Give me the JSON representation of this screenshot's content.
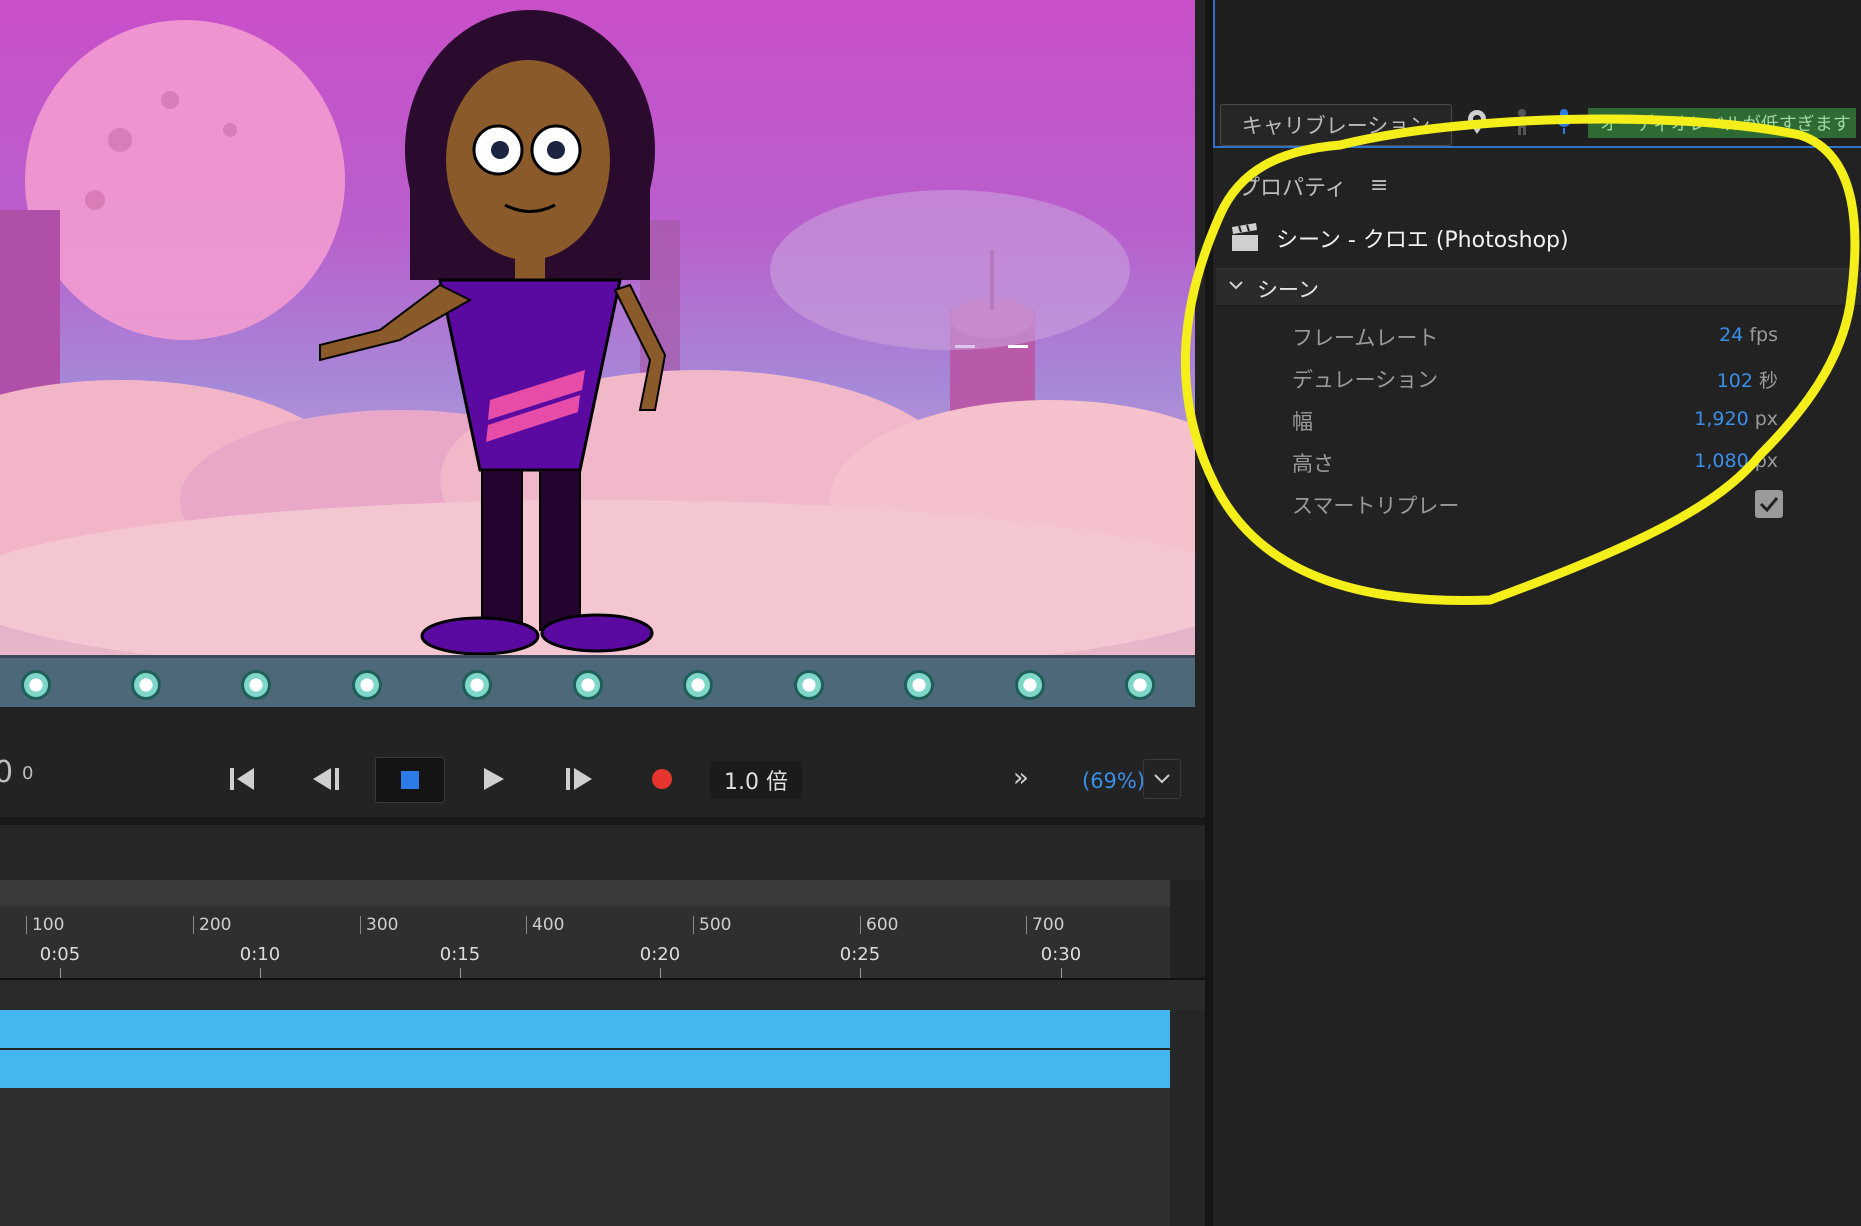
{
  "transport": {
    "frame_prefix": "0",
    "frame_number": "0",
    "speed": "1.0 倍",
    "zoom": "(69%)",
    "skip_glyph": "»"
  },
  "timeline": {
    "frame_ticks": [
      "100",
      "200",
      "300",
      "400",
      "500",
      "600",
      "700"
    ],
    "time_ticks": [
      "0:05",
      "0:10",
      "0:15",
      "0:20",
      "0:25",
      "0:30"
    ]
  },
  "camera_panel": {
    "calibration_label": "キャリブレーション",
    "audio_warning": "オーディオレベルが低すぎます"
  },
  "properties": {
    "header": "プロパティ",
    "menu_glyph": "≡",
    "scene_title": "シーン - クロエ (Photoshop)",
    "section_label": "シーン",
    "rows": [
      {
        "label": "フレームレート",
        "value": "24",
        "unit": "fps"
      },
      {
        "label": "デュレーション",
        "value": "102",
        "unit": "秒"
      },
      {
        "label": "幅",
        "value": "1,920",
        "unit": "px"
      },
      {
        "label": "高さ",
        "value": "1,080",
        "unit": "px"
      },
      {
        "label": "スマートリプレー",
        "checked": true
      }
    ]
  },
  "colors": {
    "accent_blue": "#3a8fe8",
    "track_blue": "#46b7ee",
    "record_red": "#e5352e",
    "annotation_yellow": "#f4ef1a"
  },
  "icons": [
    "go-to-start-icon",
    "step-back-icon",
    "stop-icon",
    "play-icon",
    "step-forward-icon",
    "record-icon",
    "chevron-down-icon",
    "clapperboard-icon",
    "checkmark-icon",
    "pin-icon",
    "person-icon",
    "microphone-icon"
  ]
}
